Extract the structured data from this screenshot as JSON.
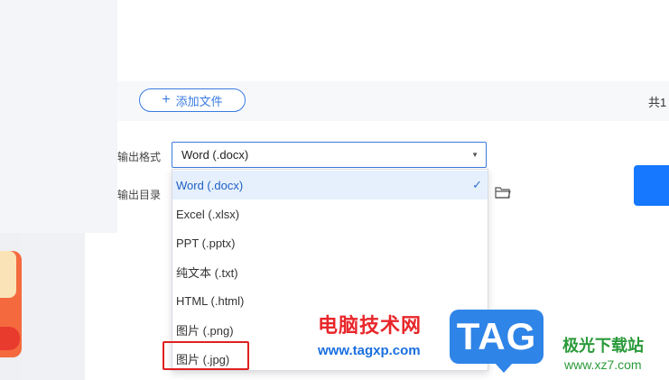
{
  "file_list": {
    "add_button_label": "添加文件",
    "count_text": "共1"
  },
  "settings": {
    "output_format_label": "输出格式",
    "output_dir_label": "输出目录",
    "selected_format": "Word (.docx)"
  },
  "dropdown": {
    "options": [
      {
        "label": "Word (.docx)",
        "selected": true
      },
      {
        "label": "Excel (.xlsx)",
        "selected": false
      },
      {
        "label": "PPT (.pptx)",
        "selected": false
      },
      {
        "label": "纯文本 (.txt)",
        "selected": false
      },
      {
        "label": "HTML (.html)",
        "selected": false
      },
      {
        "label": "图片 (.png)",
        "selected": false
      },
      {
        "label": "图片 (.jpg)",
        "selected": false
      }
    ],
    "check_icon": "check-icon"
  },
  "watermark": {
    "site_name": "电脑技术网",
    "site_url": "www.tagxp.com",
    "logo_text": "TAG",
    "partner_name": "极光下载站",
    "partner_url": "www.xz7.com"
  },
  "colors": {
    "accent": "#3a7be0",
    "primary_button": "#1677ff",
    "highlight": "#e02020"
  }
}
